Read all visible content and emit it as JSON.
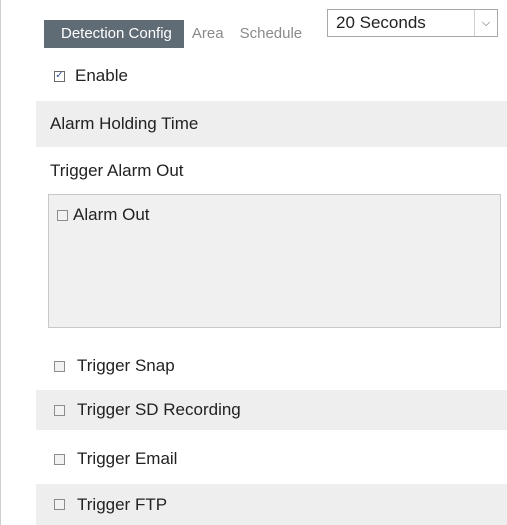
{
  "tabs": [
    {
      "label": "Detection Config",
      "active": true
    },
    {
      "label": "Area",
      "active": false
    },
    {
      "label": "Schedule",
      "active": false
    }
  ],
  "enable": {
    "label": "Enable",
    "checked": true
  },
  "alarm_holding_time": {
    "label": "Alarm Holding Time",
    "selected": "20 Seconds"
  },
  "trigger_alarm_out": {
    "title": "Trigger Alarm Out",
    "items": [
      {
        "label": "Alarm Out",
        "checked": false
      }
    ]
  },
  "triggers": [
    {
      "label": "Trigger Snap",
      "checked": false
    },
    {
      "label": "Trigger SD Recording",
      "checked": false
    },
    {
      "label": "Trigger Email",
      "checked": false
    },
    {
      "label": "Trigger FTP",
      "checked": false
    }
  ],
  "colors": {
    "active_tab_bg": "#5f6b75",
    "row_shade": "#eeeeee",
    "check_mark": "#2b4f9a"
  }
}
